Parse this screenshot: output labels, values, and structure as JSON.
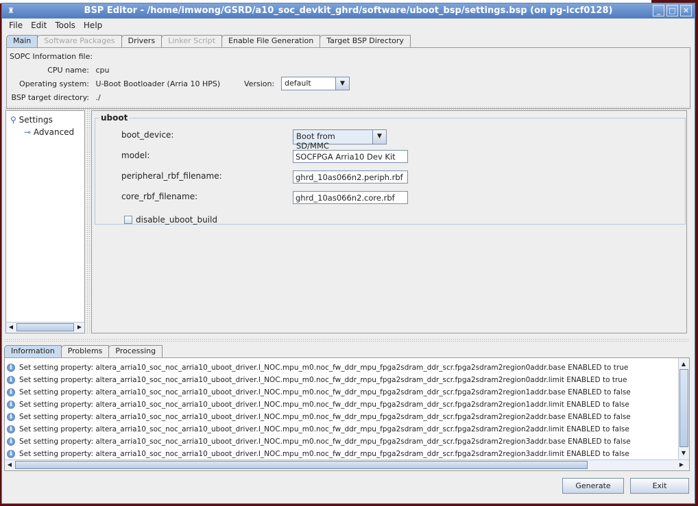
{
  "window": {
    "title": "BSP Editor - /home/imwong/GSRD/a10_soc_devkit_ghrd/software/uboot_bsp/settings.bsp (on pg-iccf0128)"
  },
  "menu": [
    "File",
    "Edit",
    "Tools",
    "Help"
  ],
  "tabs": [
    {
      "label": "Main",
      "state": "active"
    },
    {
      "label": "Software Packages",
      "state": "disabled"
    },
    {
      "label": "Drivers",
      "state": "normal"
    },
    {
      "label": "Linker Script",
      "state": "disabled"
    },
    {
      "label": "Enable File Generation",
      "state": "normal"
    },
    {
      "label": "Target BSP Directory",
      "state": "normal"
    }
  ],
  "info": {
    "sopc_label": "SOPC Information file:",
    "sopc_value": "",
    "cpu_label": "CPU name:",
    "cpu_value": "cpu",
    "os_label": "Operating system:",
    "os_value": "U-Boot Bootloader (Arria 10 HPS)",
    "version_label": "Version:",
    "version_value": "default",
    "bspdir_label": "BSP target directory:",
    "bspdir_value": "./"
  },
  "tree": {
    "root": "Settings",
    "child": "Advanced"
  },
  "uboot": {
    "group": "uboot",
    "boot_device_label": "boot_device:",
    "boot_device_value": "Boot from SD/MMC",
    "model_label": "model:",
    "model_value": "SOCFPGA Arria10 Dev Kit",
    "periph_label": "peripheral_rbf_filename:",
    "periph_value": "ghrd_10as066n2.periph.rbf",
    "core_label": "core_rbf_filename:",
    "core_value": "ghrd_10as066n2.core.rbf",
    "disable_label": "disable_uboot_build",
    "disable_checked": false
  },
  "bottom_tabs": [
    "Information",
    "Problems",
    "Processing"
  ],
  "log": [
    "Set setting property: altera_arria10_soc_noc_arria10_uboot_driver.I_NOC.mpu_m0.noc_fw_ddr_mpu_fpga2sdram_ddr_scr.fpga2sdram2region0addr.base ENABLED to true",
    "Set setting property: altera_arria10_soc_noc_arria10_uboot_driver.I_NOC.mpu_m0.noc_fw_ddr_mpu_fpga2sdram_ddr_scr.fpga2sdram2region0addr.limit ENABLED to true",
    "Set setting property: altera_arria10_soc_noc_arria10_uboot_driver.I_NOC.mpu_m0.noc_fw_ddr_mpu_fpga2sdram_ddr_scr.fpga2sdram2region1addr.base ENABLED to false",
    "Set setting property: altera_arria10_soc_noc_arria10_uboot_driver.I_NOC.mpu_m0.noc_fw_ddr_mpu_fpga2sdram_ddr_scr.fpga2sdram2region1addr.limit ENABLED to false",
    "Set setting property: altera_arria10_soc_noc_arria10_uboot_driver.I_NOC.mpu_m0.noc_fw_ddr_mpu_fpga2sdram_ddr_scr.fpga2sdram2region2addr.base ENABLED to false",
    "Set setting property: altera_arria10_soc_noc_arria10_uboot_driver.I_NOC.mpu_m0.noc_fw_ddr_mpu_fpga2sdram_ddr_scr.fpga2sdram2region2addr.limit ENABLED to false",
    "Set setting property: altera_arria10_soc_noc_arria10_uboot_driver.I_NOC.mpu_m0.noc_fw_ddr_mpu_fpga2sdram_ddr_scr.fpga2sdram2region3addr.base ENABLED to false",
    "Set setting property: altera_arria10_soc_noc_arria10_uboot_driver.I_NOC.mpu_m0.noc_fw_ddr_mpu_fpga2sdram_ddr_scr.fpga2sdram2region3addr.limit ENABLED to false"
  ],
  "buttons": {
    "generate": "Generate",
    "exit": "Exit"
  }
}
